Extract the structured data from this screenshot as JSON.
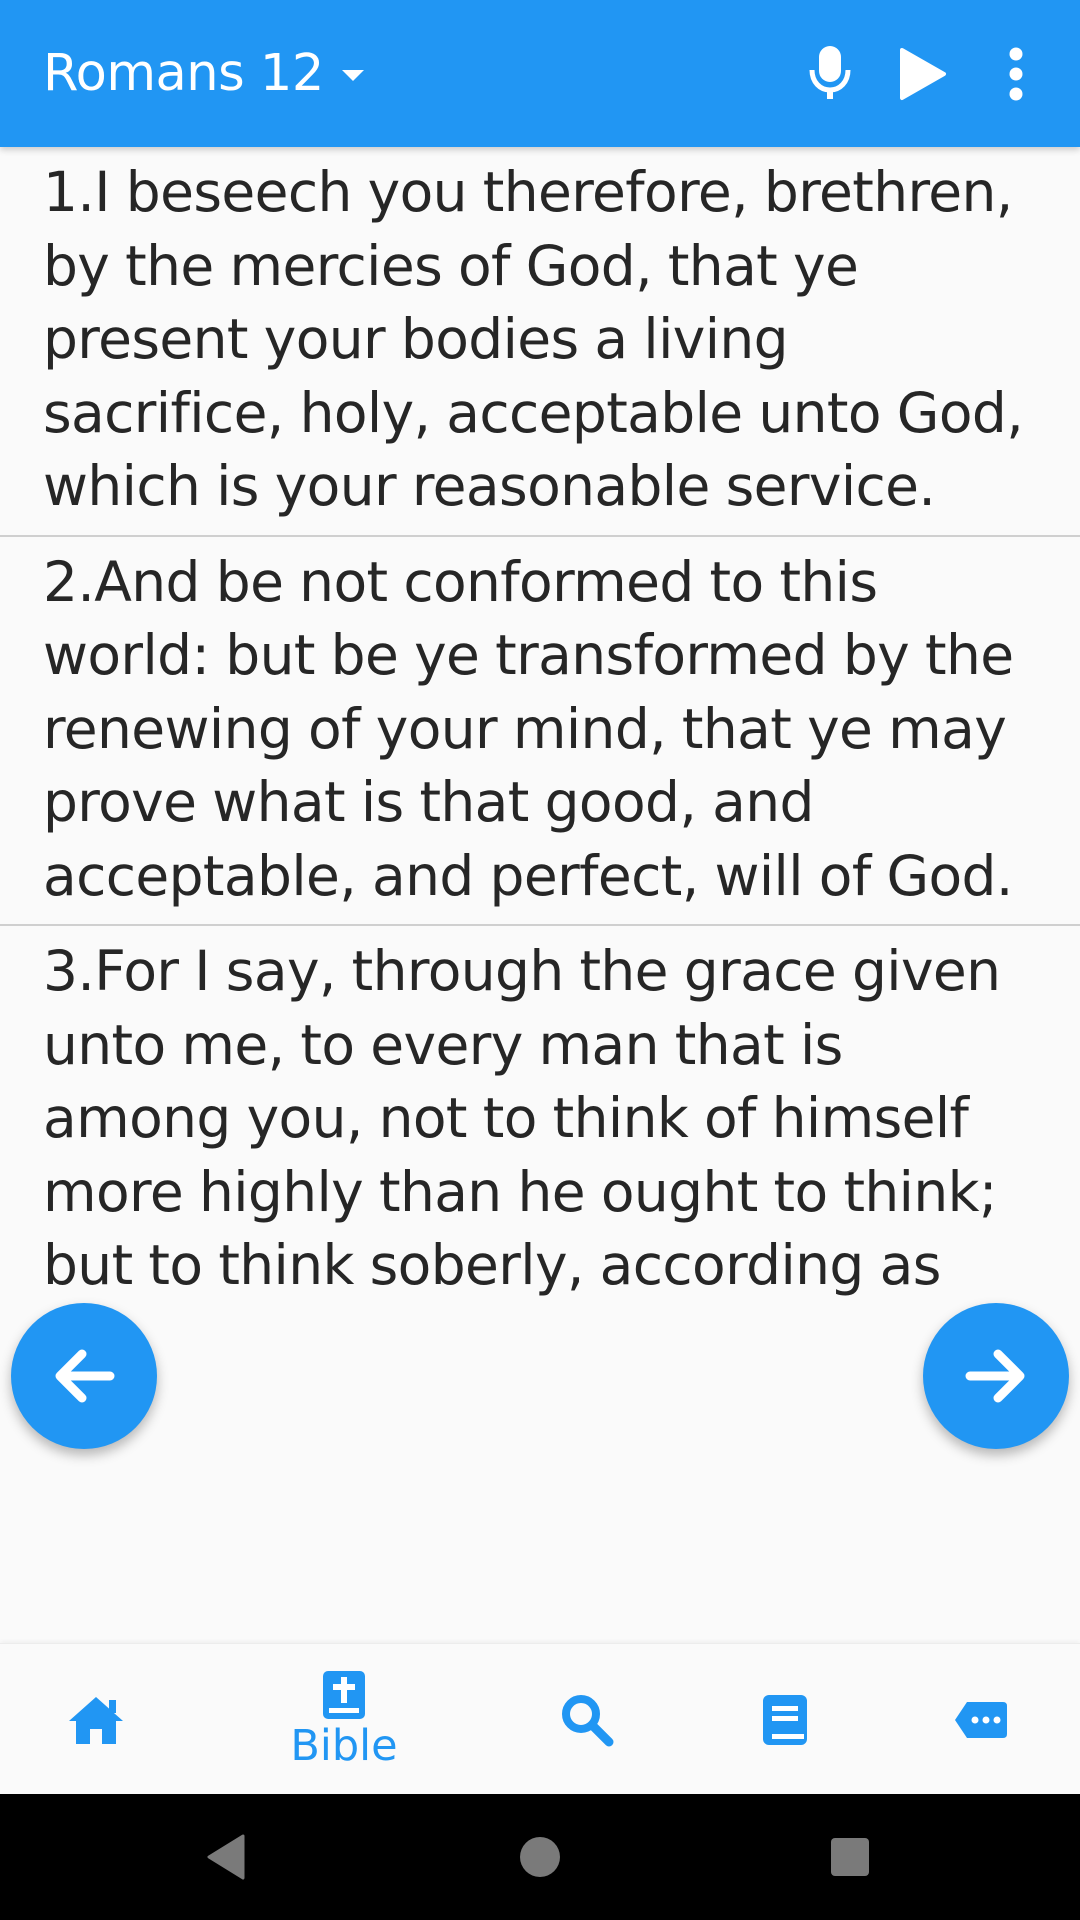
{
  "app_bar": {
    "title": "Romans 12",
    "icons": [
      "mic-icon",
      "play-icon",
      "more-vert-icon"
    ],
    "color": "#2196f3"
  },
  "verses": [
    {
      "text": "1.I beseech you therefore, brethren, by the mercies of God, that ye present your bodies a living sacrifice, holy, acceptable unto God, which is your reasonable service."
    },
    {
      "text": "2.And be not conformed to this world: but be ye transformed by the renewing of your mind, that ye may prove what is that good, and acceptable, and perfect, will of God."
    },
    {
      "text": "3.For I say, through the grace given unto me, to every man that is among you, not to think of himself more highly than he ought to think; but to think soberly, according as"
    }
  ],
  "fabs": {
    "prev_icon": "arrow-left-icon",
    "next_icon": "arrow-right-icon"
  },
  "bottom_nav": {
    "items": [
      {
        "icon": "home-icon",
        "label": ""
      },
      {
        "icon": "bible-icon",
        "label": "Bible",
        "selected": true
      },
      {
        "icon": "search-icon",
        "label": ""
      },
      {
        "icon": "book-icon",
        "label": ""
      },
      {
        "icon": "chat-bubble-icon",
        "label": ""
      }
    ],
    "accent": "#2196f3"
  },
  "system_nav": {
    "icons": [
      "back-icon",
      "home-circle-icon",
      "recents-icon"
    ]
  }
}
